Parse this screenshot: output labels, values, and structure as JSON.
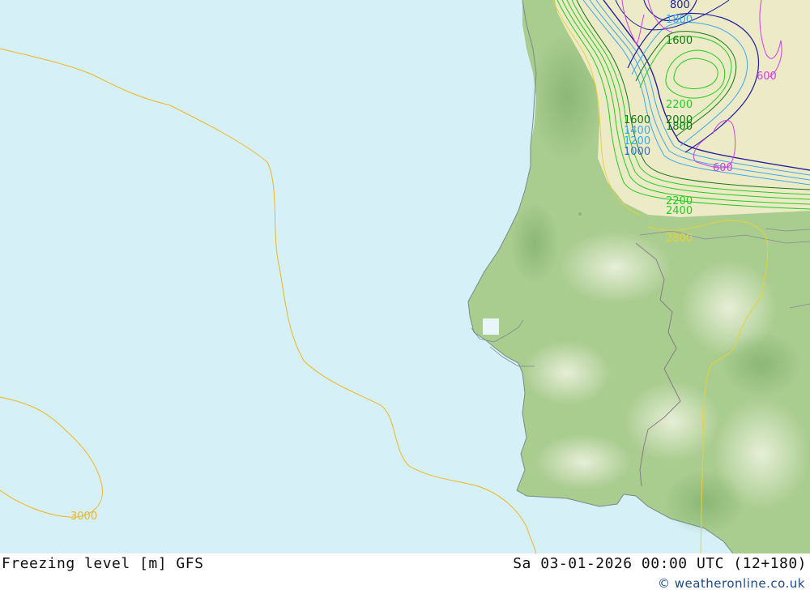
{
  "footer": {
    "title": "Freezing level [m] GFS",
    "validity": "Sa 03-01-2026 00:00 UTC (12+180)",
    "credit": "© weatheronline.co.uk"
  },
  "contour_labels": {
    "l3000": "3000",
    "l2800": "2800",
    "l2400": "2400",
    "l2200": "2200",
    "l2200b": "2200",
    "l2000": "2000",
    "l1800": "1800",
    "l1800b": "1800",
    "l1600a": "1600",
    "l1600b": "1600",
    "l1400": "1400",
    "l1200": "1200",
    "l1000": "1000",
    "l800": "800",
    "l600a": "600",
    "l600b": "600"
  },
  "colors": {
    "sea": "#d6f0f8",
    "land_green": "#a9cc8f",
    "land_yellow": "#f3edcc",
    "contour_3000": "#f0b420",
    "contour_2800": "#e6d23a",
    "contour_green": "#22cc22",
    "contour_dark_green": "#147814",
    "contour_blue": "#3aa8e8",
    "contour_navy": "#2020a0",
    "contour_magenta": "#d040e0"
  }
}
